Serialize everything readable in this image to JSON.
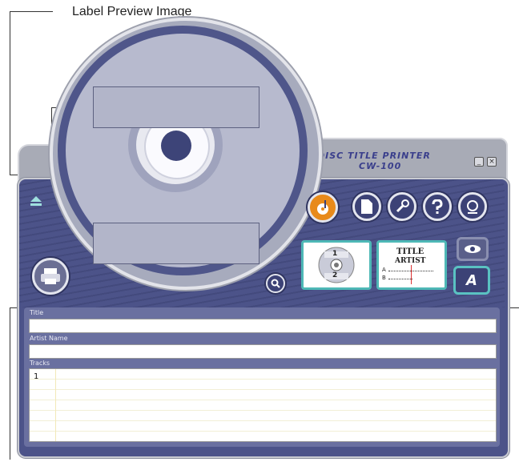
{
  "callout": {
    "label": "Label Preview Image"
  },
  "window": {
    "title_line1": "DISC TITLE PRINTER",
    "title_line2": "CW-100",
    "minimize": "_",
    "close": "×"
  },
  "fields": {
    "title_label": "Title",
    "artist_label": "Artist Name",
    "tracks_label": "Tracks",
    "first_track_number": "1"
  },
  "layout_card": {
    "top_num": "1",
    "bottom_num": "2"
  },
  "text_card": {
    "title": "TITLE",
    "artist": "ARTIST",
    "line_a": "A",
    "line_b": "B"
  },
  "font_button": {
    "label": "A"
  },
  "colors": {
    "accent": "#4eb8b6",
    "body": "#4c5389",
    "orange": "#e88a1a"
  }
}
